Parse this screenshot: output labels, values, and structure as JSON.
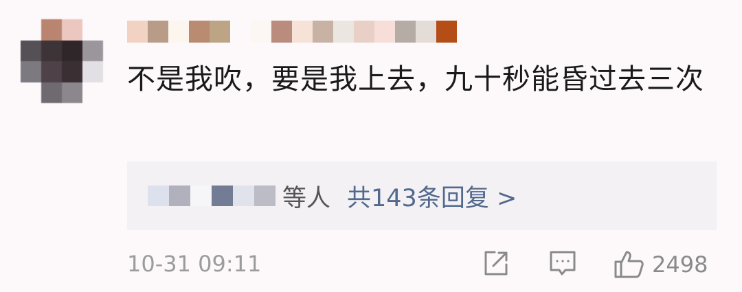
{
  "comment": {
    "avatar_colors": [
      "#fdf9fb",
      "#b98470",
      "#ecc7c0",
      "#fdf9fb",
      "#555055",
      "#3c3437",
      "#2e2628",
      "#9a969b",
      "#7c7a80",
      "#4e4148",
      "#3a3034",
      "#e2e0e4",
      "#fdf9fb",
      "#6e6a70",
      "#8c878d",
      "#fdf9fb"
    ],
    "username_colors": [
      "#f1d2c3",
      "#b89c87",
      "#fdf6ee",
      "#b98c72",
      "#bca484",
      "#fdf9fb",
      "#fdf7f3",
      "#b98c7e",
      "#f6e2d6",
      "#c8b2a4",
      "#ece6e0",
      "#e8d0c6",
      "#f8ded8",
      "#b6aca6",
      "#e4dcd6",
      "#b44d16"
    ],
    "text": "不是我吹，要是我上去，九十秒能昏过去三次",
    "replies": {
      "replier_colors": [
        "#dde0ed",
        "#b0b1bc",
        "#f6f5f8",
        "#737c95",
        "#e0e2ec",
        "#bcbcc7"
      ],
      "by_label": "等人",
      "link_label": "共143条回复 >"
    },
    "timestamp": "10-31 09:11",
    "actions": {
      "share_icon": "share-icon",
      "comment_icon": "comment-icon",
      "like_icon": "thumbs-up-icon",
      "like_count": "2498"
    },
    "colors": {
      "text": "#1a1a1a",
      "link": "#52698e",
      "meta": "#9c9c9c",
      "reply_bg": "#f3f1f4"
    }
  }
}
